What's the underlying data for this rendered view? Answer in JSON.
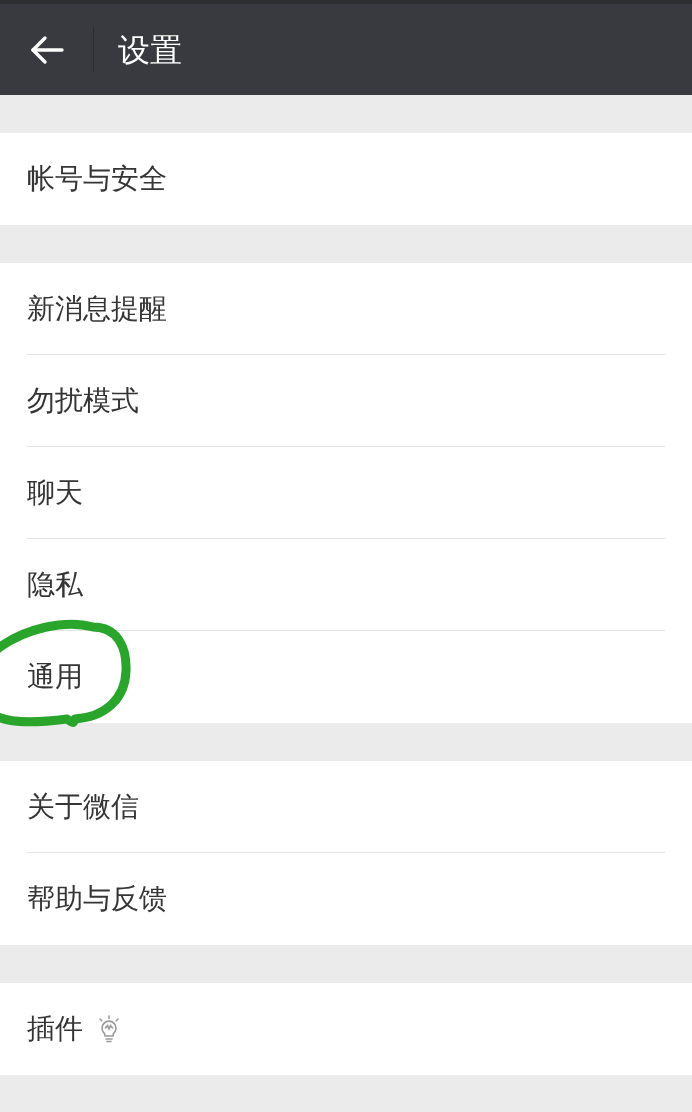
{
  "header": {
    "title": "设置"
  },
  "sections": [
    {
      "items": [
        {
          "label": "帐号与安全",
          "kind": "plain",
          "circled": false
        }
      ]
    },
    {
      "items": [
        {
          "label": "新消息提醒",
          "kind": "plain",
          "circled": false
        },
        {
          "label": "勿扰模式",
          "kind": "plain",
          "circled": false
        },
        {
          "label": "聊天",
          "kind": "plain",
          "circled": false
        },
        {
          "label": "隐私",
          "kind": "plain",
          "circled": false
        },
        {
          "label": "通用",
          "kind": "plain",
          "circled": true
        }
      ]
    },
    {
      "items": [
        {
          "label": "关于微信",
          "kind": "plain",
          "circled": false
        },
        {
          "label": "帮助与反馈",
          "kind": "plain",
          "circled": false
        }
      ]
    },
    {
      "items": [
        {
          "label": "插件",
          "kind": "bulb",
          "circled": false
        }
      ]
    }
  ]
}
